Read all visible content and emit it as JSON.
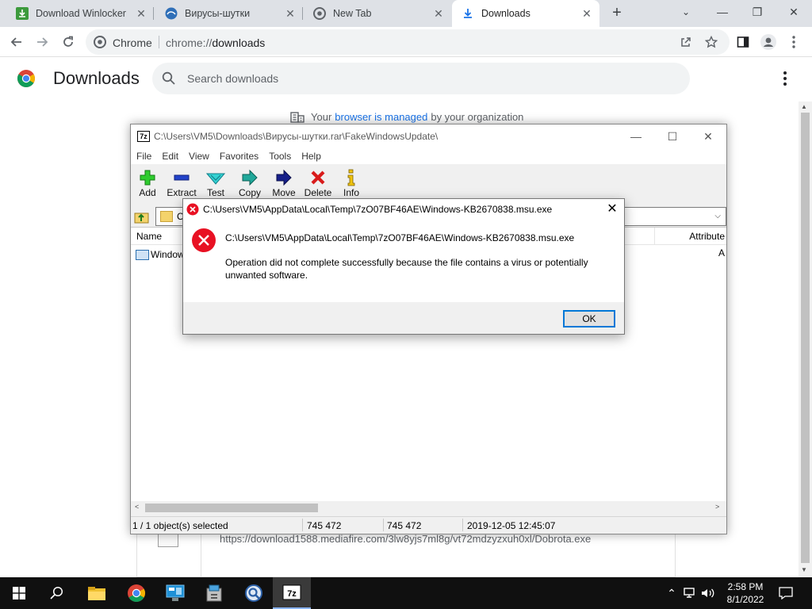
{
  "tabs": [
    {
      "label": "Download Winlocker bat"
    },
    {
      "label": "Вирусы-шутки"
    },
    {
      "label": "New Tab"
    },
    {
      "label": "Downloads"
    }
  ],
  "toolbar": {
    "omnibox_site": "Chrome",
    "omnibox_scheme": "chrome://",
    "omnibox_path": "downloads"
  },
  "downloads_page": {
    "title": "Downloads",
    "search_placeholder": "Search downloads",
    "managed_prefix": "Your",
    "managed_link": "browser is managed",
    "managed_suffix": "by your organization",
    "item_url": "https://download1588.mediafire.com/3lw8yjs7ml8g/vt72mdzyzxuh0xl/Dobrota.exe"
  },
  "zip_window": {
    "title": "C:\\Users\\VM5\\Downloads\\Вирусы-шутки.rar\\FakeWindowsUpdate\\",
    "menu": [
      "File",
      "Edit",
      "View",
      "Favorites",
      "Tools",
      "Help"
    ],
    "tools": [
      {
        "label": "Add",
        "icon": "plus-icon"
      },
      {
        "label": "Extract",
        "icon": "minus-icon"
      },
      {
        "label": "Test",
        "icon": "check-icon"
      },
      {
        "label": "Copy",
        "icon": "arrow-right-icon"
      },
      {
        "label": "Move",
        "icon": "arrow-right-icon"
      },
      {
        "label": "Delete",
        "icon": "x-icon"
      },
      {
        "label": "Info",
        "icon": "info-icon"
      }
    ],
    "address": "C",
    "col_name": "Name",
    "col_attributes": "Attribute",
    "row_name": "Window",
    "row_attr": "A",
    "status": {
      "selected": "1 / 1 object(s) selected",
      "size": "745 472",
      "packed": "745 472",
      "modified": "2019-12-05 12:45:07"
    }
  },
  "error_dialog": {
    "title": "C:\\Users\\VM5\\AppData\\Local\\Temp\\7zO07BF46AE\\Windows-KB2670838.msu.exe",
    "path": "C:\\Users\\VM5\\AppData\\Local\\Temp\\7zO07BF46AE\\Windows-KB2670838.msu.exe",
    "message": "Operation did not complete successfully because the file contains a virus or potentially unwanted software.",
    "ok_label": "OK"
  },
  "taskbar": {
    "time": "2:58 PM",
    "date": "8/1/2022"
  },
  "colors": {
    "accent": "#1a73e8",
    "error": "#e81123",
    "taskbar": "#101010"
  }
}
